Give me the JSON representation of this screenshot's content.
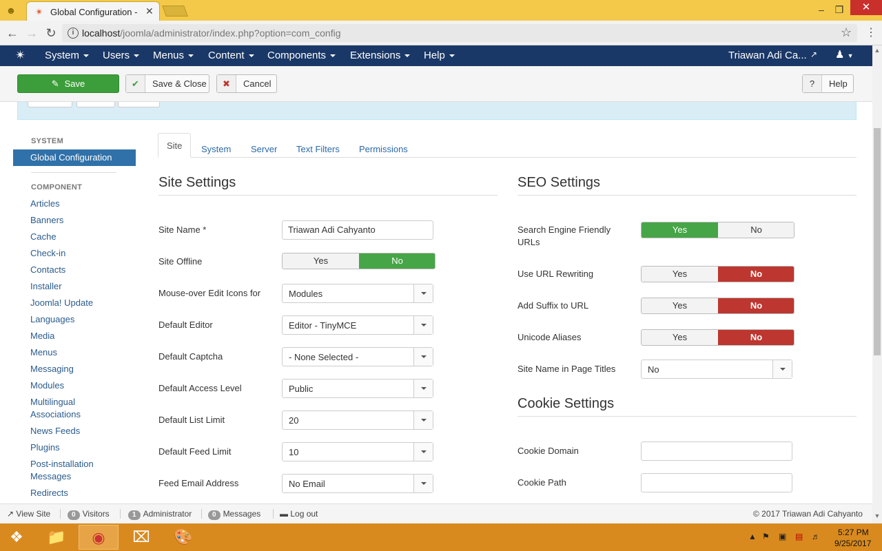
{
  "browser": {
    "tab_title": "Global Configuration - Tr",
    "url_host": "localhost",
    "url_path": "/joomla/administrator/index.php?option=com_config"
  },
  "nav": {
    "menus": [
      "System",
      "Users",
      "Menus",
      "Content",
      "Components",
      "Extensions",
      "Help"
    ],
    "user": "Triawan Adi Ca..."
  },
  "toolbar": {
    "save": "Save",
    "save_close": "Save & Close",
    "cancel": "Cancel",
    "help": "Help"
  },
  "sidebar": {
    "system_heading": "SYSTEM",
    "active_item": "Global Configuration",
    "component_heading": "COMPONENT",
    "items": [
      "Articles",
      "Banners",
      "Cache",
      "Check-in",
      "Contacts",
      "Installer",
      "Joomla! Update",
      "Languages",
      "Media",
      "Menus",
      "Messaging",
      "Modules",
      "Multilingual Associations",
      "News Feeds",
      "Plugins",
      "Post-installation Messages",
      "Redirects"
    ]
  },
  "tabs": [
    "Site",
    "System",
    "Server",
    "Text Filters",
    "Permissions"
  ],
  "site_settings": {
    "heading": "Site Settings",
    "site_name_label": "Site Name *",
    "site_name_value": "Triawan Adi Cahyanto",
    "site_offline_label": "Site Offline",
    "yes": "Yes",
    "no": "No",
    "mouseover_label": "Mouse-over Edit Icons for",
    "mouseover_value": "Modules",
    "editor_label": "Default Editor",
    "editor_value": "Editor - TinyMCE",
    "captcha_label": "Default Captcha",
    "captcha_value": "- None Selected -",
    "access_label": "Default Access Level",
    "access_value": "Public",
    "list_limit_label": "Default List Limit",
    "list_limit_value": "20",
    "feed_limit_label": "Default Feed Limit",
    "feed_limit_value": "10",
    "feed_email_label": "Feed Email Address",
    "feed_email_value": "No Email"
  },
  "seo_settings": {
    "heading": "SEO Settings",
    "sef_label": "Search Engine Friendly URLs",
    "rewrite_label": "Use URL Rewriting",
    "suffix_label": "Add Suffix to URL",
    "unicode_label": "Unicode Aliases",
    "sitename_titles_label": "Site Name in Page Titles",
    "sitename_titles_value": "No"
  },
  "cookie_settings": {
    "heading": "Cookie Settings",
    "domain_label": "Cookie Domain",
    "path_label": "Cookie Path"
  },
  "statusbar": {
    "view_site": "View Site",
    "visitors_count": "0",
    "visitors": "Visitors",
    "admin_count": "1",
    "admin": "Administrator",
    "messages_count": "0",
    "messages": "Messages",
    "logout": "Log out",
    "copyright": "© 2017 Triawan Adi Cahyanto"
  },
  "taskbar": {
    "time": "5:27 PM",
    "date": "9/25/2017"
  },
  "colors": {
    "nav": "#1a3867",
    "save_green": "#3c9e3a",
    "toggle_green": "#46a546",
    "toggle_red": "#bd362f",
    "active_sidebar": "#3071a9"
  }
}
